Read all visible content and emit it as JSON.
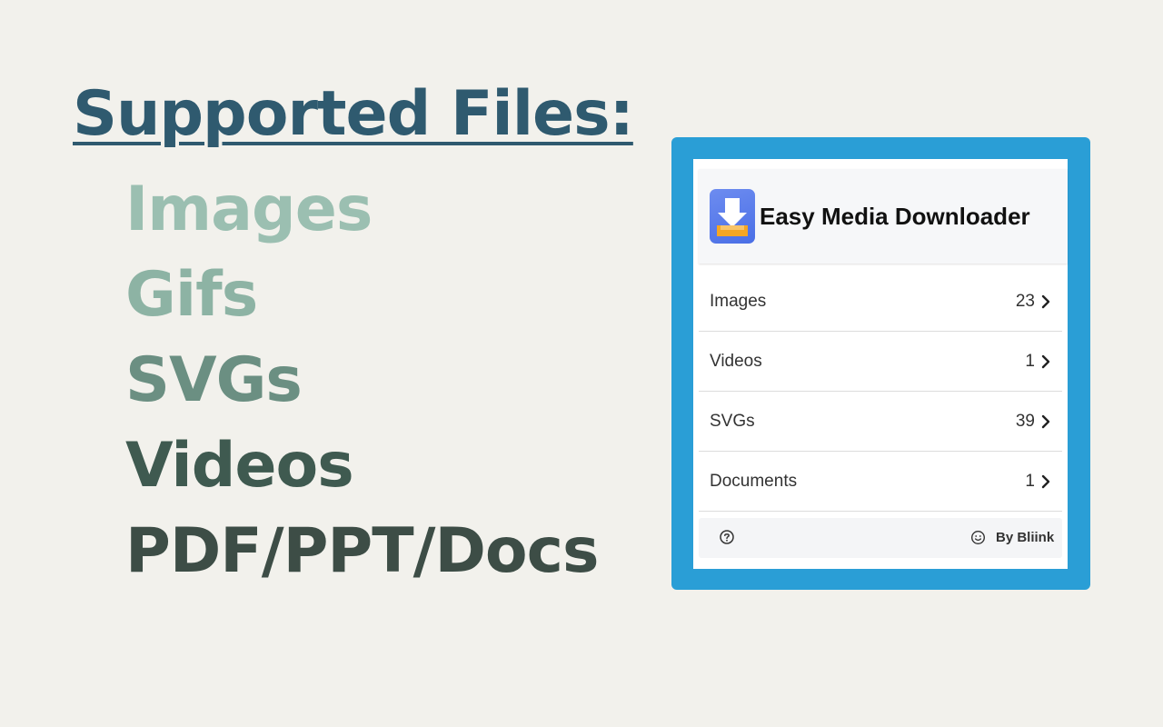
{
  "heading": "Supported Files:",
  "file_types": [
    {
      "label": "Images",
      "color": "#9bbfb1"
    },
    {
      "label": "Gifs",
      "color": "#8db3a4"
    },
    {
      "label": "SVGs",
      "color": "#6b8f82"
    },
    {
      "label": "Videos",
      "color": "#3f5a50"
    },
    {
      "label": "PDF/PPT/Docs",
      "color": "#3d4d46"
    }
  ],
  "popup": {
    "title": "Easy Media Downloader",
    "frame_color": "#2a9ed6",
    "icon": "download-tray-icon",
    "rows": [
      {
        "label": "Images",
        "count": "23"
      },
      {
        "label": "Videos",
        "count": "1"
      },
      {
        "label": "SVGs",
        "count": "39"
      },
      {
        "label": "Documents",
        "count": "1"
      }
    ],
    "footer": {
      "help_icon": "question-circle-icon",
      "credit_icon": "smile-icon",
      "credit": "By Bliink"
    }
  }
}
